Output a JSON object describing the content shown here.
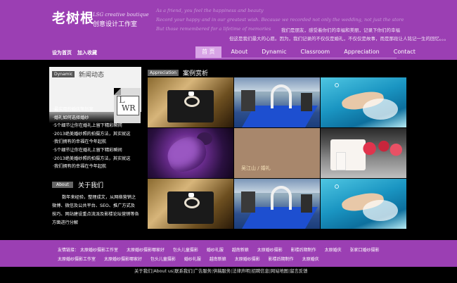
{
  "header": {
    "logo_main": "老树根",
    "logo_en": "LSG creative boutique",
    "logo_sub": "创意设计工作室",
    "tagline": {
      "en_line1": "As a friend, you feel the happiness and beauty",
      "en_line2": "Record your happy and in our greatest wish. Because we recorded not only the wedding, not just the store",
      "en_line3": "But those remembered for a lifetime of memories",
      "cn_line1": "我们是朋友，感受着你们的幸福和美丽，记录下你们的幸福",
      "cn_line2": "但这是我们最大的心愿。因为，我们记录的不仅仅是婚礼，不仅仅是故事，而是那段让人铭记一生的回忆。。。"
    },
    "quick_links": [
      "设为首页",
      "加入收藏"
    ],
    "nav": [
      "首 页",
      "About",
      "Dynamic",
      "Classroom",
      "Appreciation",
      "Contact"
    ],
    "nav_active_index": 0
  },
  "news": {
    "tag": "Dynamic",
    "title": "新闻动态",
    "badge_letter": "L",
    "badge_text": "WR",
    "items": [
      "·最实用的婚庆策划案",
      "·婚礼如何选择婚纱",
      "·5个细节让你在婚礼上留下精彩瞬间",
      "·2013绝美婚纱照的拍摄方法，其实就这",
      "·我们拥有的幸福在今年起航",
      "·5个细节让你在婚礼上留下精彩瞬间",
      "·2013绝美婚纱照的拍摄方法，其实就这",
      "·我们拥有的幸福在今年起航"
    ]
  },
  "about": {
    "tag": "About",
    "title": "关于我们",
    "text": "数年来经验，整理成文，从网络营销之微博、微信及公共平台、SEO、推广方式及技巧、网站建设重点流派及影楼论坛营销等各方面进行分解"
  },
  "appreciation": {
    "tag": "Appreciation",
    "title": "案例赏析",
    "caption_main": "吴江山",
    "caption_sep": " / ",
    "caption_tag": "婚礼"
  },
  "footer": {
    "friend_label": "友情链接：",
    "row1": [
      "太原婚纱摄影工作室",
      "太原婚纱摄影哪家好",
      "包头儿童摄影",
      "婚纱礼服",
      "越南新娘",
      "太原婚纱摄影",
      "影楼后期制作",
      "太原婚庆",
      "张家口婚纱摄影"
    ],
    "row2": [
      "太原婚纱摄影工作室",
      "太原婚纱摄影哪家好",
      "包头儿童摄影",
      "婚纱礼服",
      "越南新娘",
      "太原婚纱摄影",
      "影楼后期制作",
      "太原婚庆"
    ],
    "bottom_links": [
      "关于我们",
      "About us",
      "联系我们",
      "广告服务",
      "供稿服务",
      "法律声明",
      "招聘信息",
      "网站地图",
      "留言反馈"
    ]
  },
  "colors": {
    "brand_purple": "#9b3fb3",
    "nav_active": "#d8a3e6",
    "background": "#000000"
  }
}
